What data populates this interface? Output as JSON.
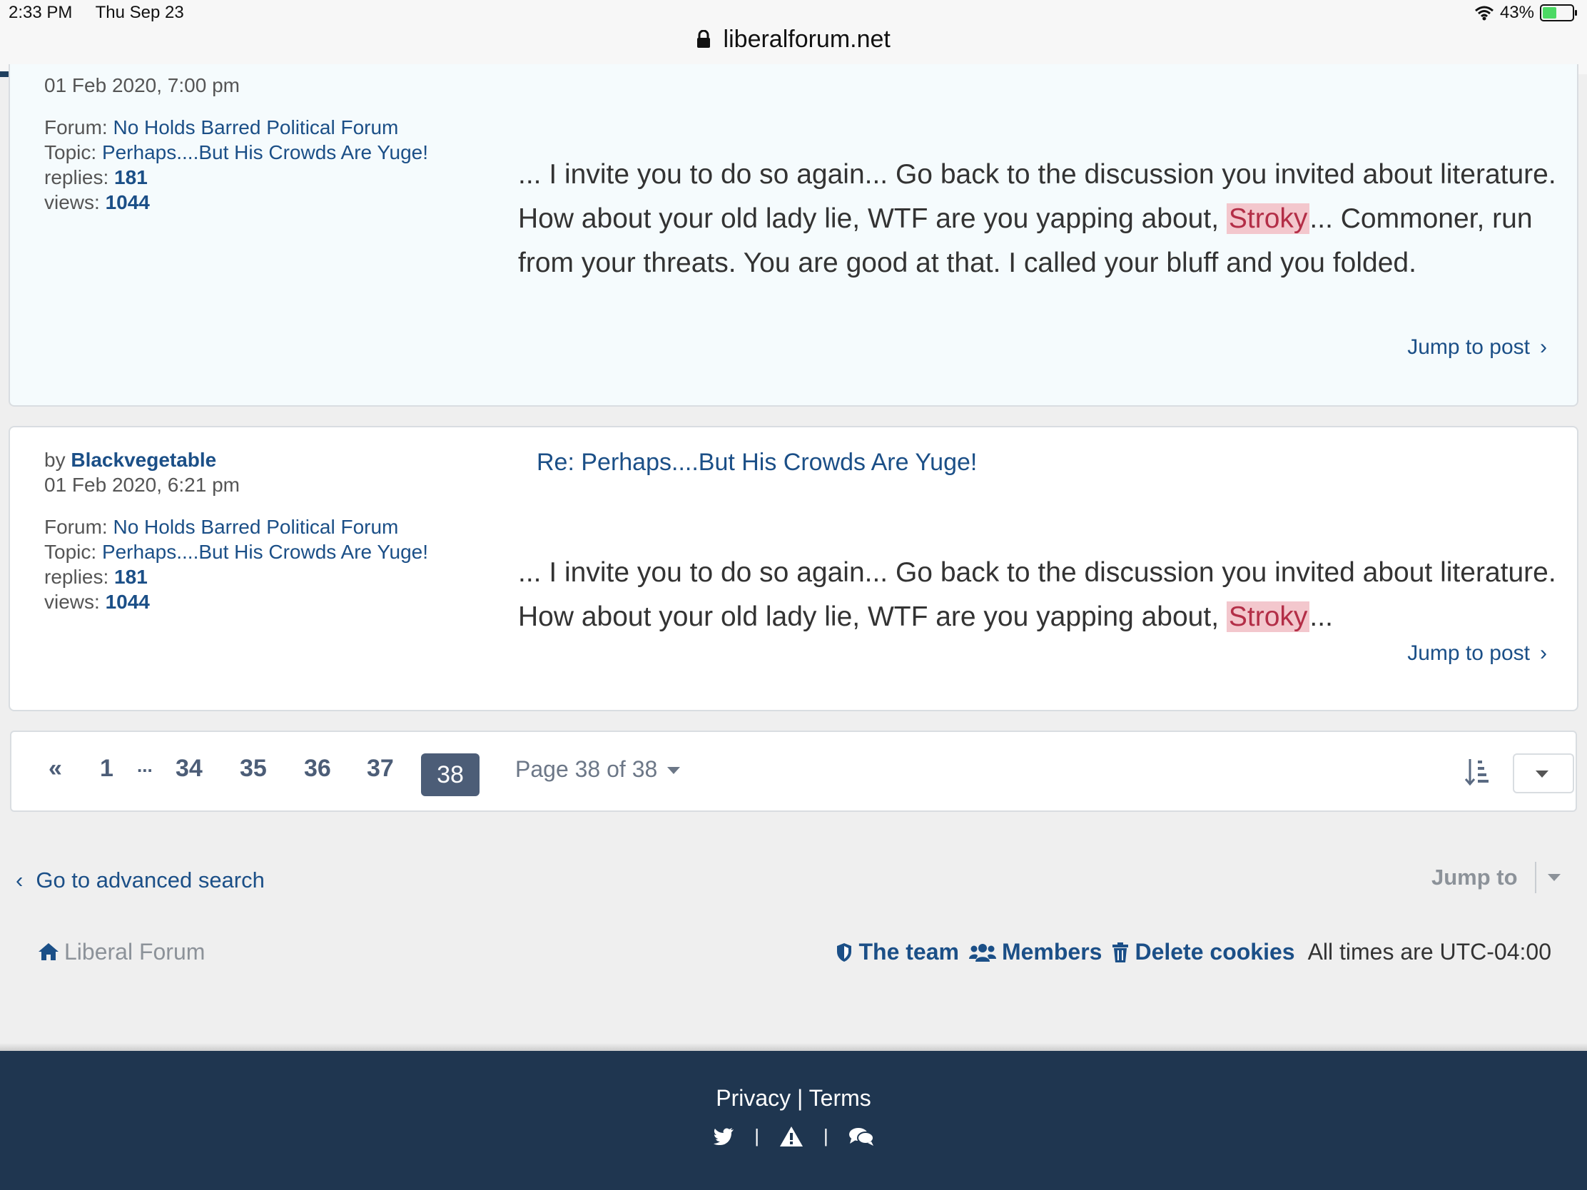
{
  "status_bar": {
    "time": "2:33 PM",
    "date": "Thu Sep 23",
    "battery": "43%"
  },
  "browser": {
    "url": "liberalforum.net"
  },
  "posts": [
    {
      "date": "01 Feb 2020, 7:00 pm",
      "forum_label": "Forum:",
      "forum": "No Holds Barred Political Forum",
      "topic_label": "Topic:",
      "topic": "Perhaps....But His Crowds Are Yuge!",
      "replies_label": "replies:",
      "replies": "181",
      "views_label": "views:",
      "views": "1044",
      "body_before": "... I invite you to do so again... Go back to the discussion you invited about literature. How about your old lady lie, WTF are you yapping about, ",
      "highlight": "Stroky",
      "body_after": "... Commoner, run from your threats. You are good at that. I called your bluff and you folded.",
      "jump": "Jump to post"
    },
    {
      "by_label": "by",
      "author": "Blackvegetable",
      "date": "01 Feb 2020, 6:21 pm",
      "title": "Re: Perhaps....But His Crowds Are Yuge!",
      "forum_label": "Forum:",
      "forum": "No Holds Barred Political Forum",
      "topic_label": "Topic:",
      "topic": "Perhaps....But His Crowds Are Yuge!",
      "replies_label": "replies:",
      "replies": "181",
      "views_label": "views:",
      "views": "1044",
      "body_before": "... I invite you to do so again... Go back to the discussion you invited about literature. How about your old lady lie, WTF are you yapping about, ",
      "highlight": "Stroky",
      "body_after": "...",
      "jump": "Jump to post"
    }
  ],
  "pagination": {
    "prev": "«",
    "pages": [
      "1",
      "...",
      "34",
      "35",
      "36",
      "37"
    ],
    "current": "38",
    "page_of": "Page 38 of 38"
  },
  "nav": {
    "advanced_search": "Go to advanced search",
    "jump_to": "Jump to"
  },
  "footer_nav": {
    "home": "Liberal Forum",
    "team": "The team",
    "members": "Members",
    "delete_cookies": "Delete cookies",
    "timezone": "All times are UTC-04:00"
  },
  "footer": {
    "privacy": "Privacy",
    "separator": "|",
    "terms": "Terms"
  },
  "colors": {
    "link": "#1b4f87",
    "highlight_bg": "#f3c7cd",
    "footer_bg": "#1f3650",
    "pager_current": "#4c5d77"
  }
}
